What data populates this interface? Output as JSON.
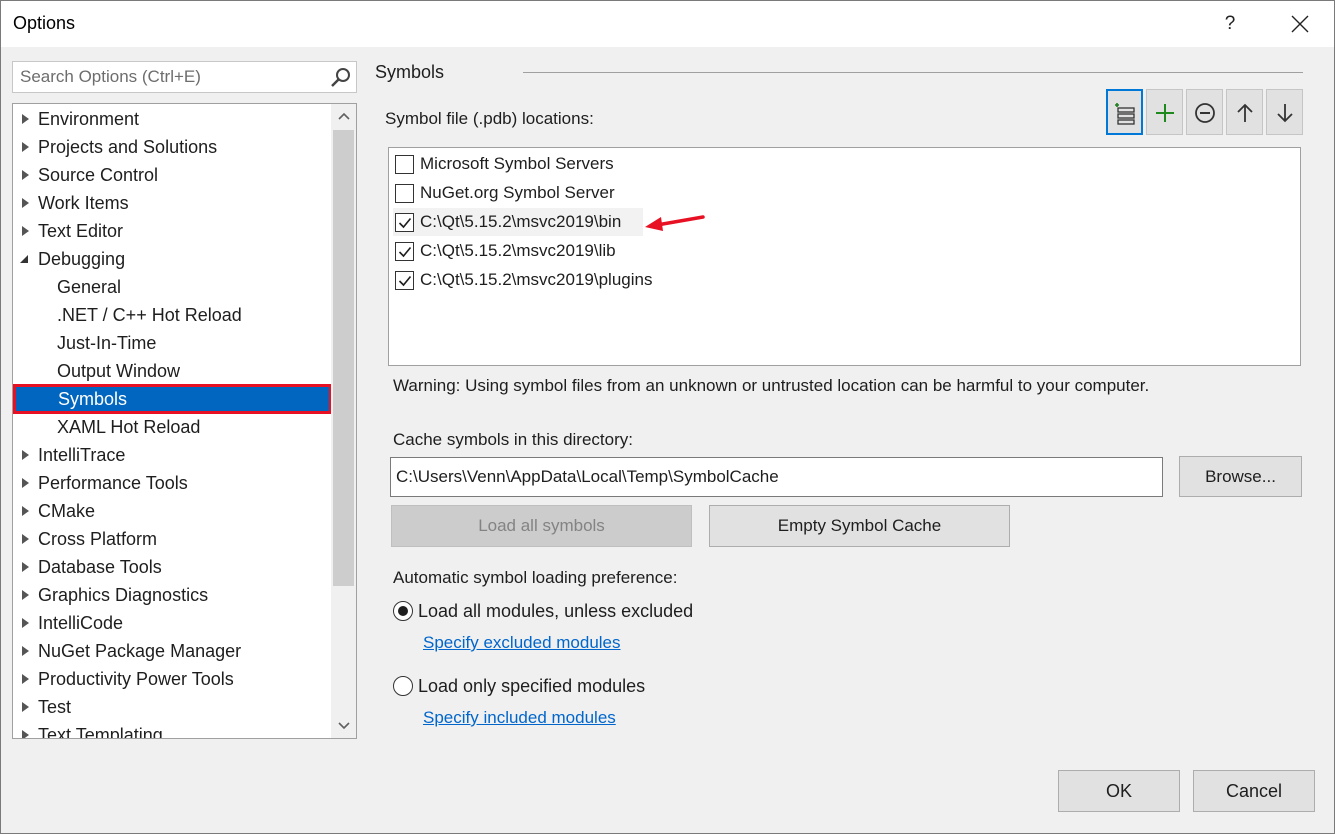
{
  "window": {
    "title": "Options",
    "help_label": "?",
    "close_label": "✕"
  },
  "search": {
    "placeholder": "Search Options (Ctrl+E)"
  },
  "tree": {
    "items": [
      {
        "label": "Environment",
        "expandable": true
      },
      {
        "label": "Projects and Solutions",
        "expandable": true
      },
      {
        "label": "Source Control",
        "expandable": true
      },
      {
        "label": "Work Items",
        "expandable": true
      },
      {
        "label": "Text Editor",
        "expandable": true
      },
      {
        "label": "Debugging",
        "expanded": true
      },
      {
        "label": "General",
        "child": true
      },
      {
        "label": ".NET / C++ Hot Reload",
        "child": true
      },
      {
        "label": "Just-In-Time",
        "child": true
      },
      {
        "label": "Output Window",
        "child": true
      },
      {
        "label": "Symbols",
        "child": true,
        "selected": true
      },
      {
        "label": "XAML Hot Reload",
        "child": true
      },
      {
        "label": "IntelliTrace",
        "expandable": true
      },
      {
        "label": "Performance Tools",
        "expandable": true
      },
      {
        "label": "CMake",
        "expandable": true
      },
      {
        "label": "Cross Platform",
        "expandable": true
      },
      {
        "label": "Database Tools",
        "expandable": true
      },
      {
        "label": "Graphics Diagnostics",
        "expandable": true
      },
      {
        "label": "IntelliCode",
        "expandable": true
      },
      {
        "label": "NuGet Package Manager",
        "expandable": true
      },
      {
        "label": "Productivity Power Tools",
        "expandable": true
      },
      {
        "label": "Test",
        "expandable": true
      },
      {
        "label": "Text Templating",
        "expandable": true
      }
    ]
  },
  "symbols": {
    "section_title": "Symbols",
    "locations_label": "Symbol file (.pdb) locations:",
    "toolbar": [
      "new-folder-icon",
      "add-icon",
      "remove-icon",
      "arrow-up-icon",
      "arrow-down-icon"
    ],
    "locations": [
      {
        "label": "Microsoft Symbol Servers",
        "checked": false
      },
      {
        "label": "NuGet.org Symbol Server",
        "checked": false
      },
      {
        "label": "C:\\Qt\\5.15.2\\msvc2019\\bin",
        "checked": true,
        "highlighted": true
      },
      {
        "label": "C:\\Qt\\5.15.2\\msvc2019\\lib",
        "checked": true
      },
      {
        "label": "C:\\Qt\\5.15.2\\msvc2019\\plugins",
        "checked": true
      }
    ],
    "warning": "Warning: Using symbol files from an unknown or untrusted location can be harmful to your computer.",
    "cache_label": "Cache symbols in this directory:",
    "cache_path": "C:\\Users\\Venn\\AppData\\Local\\Temp\\SymbolCache",
    "browse_label": "Browse...",
    "load_all_label": "Load all symbols",
    "empty_cache_label": "Empty Symbol Cache",
    "pref_label": "Automatic symbol loading preference:",
    "option_all": "Load all modules, unless excluded",
    "link_excluded": "Specify excluded modules",
    "option_only": "Load only specified modules",
    "link_included": "Specify included modules"
  },
  "footer": {
    "ok_label": "OK",
    "cancel_label": "Cancel"
  },
  "colors": {
    "selection": "#0066bf",
    "annotation_red": "#e81123",
    "link": "#0066cc"
  }
}
